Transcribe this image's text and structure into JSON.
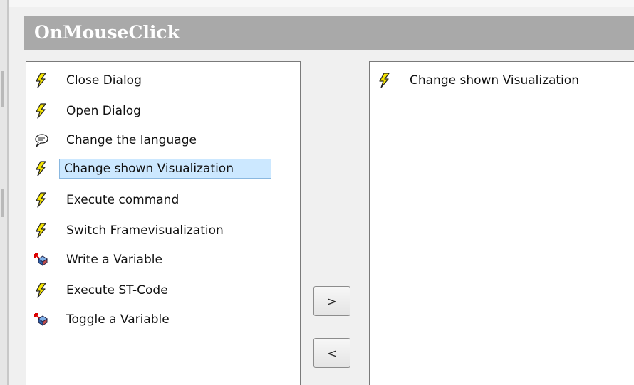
{
  "header": {
    "title": "OnMouseClick"
  },
  "available_actions": {
    "selected_index": 3,
    "items": [
      {
        "label": "Close Dialog",
        "icon": "lightning-icon"
      },
      {
        "label": "Open Dialog",
        "icon": "lightning-icon"
      },
      {
        "label": "Change the language",
        "icon": "speech-bubble-icon"
      },
      {
        "label": "Change shown Visualization",
        "icon": "lightning-icon"
      },
      {
        "label": "Execute command",
        "icon": "lightning-icon"
      },
      {
        "label": "Switch Framevisualization",
        "icon": "lightning-icon"
      },
      {
        "label": "Write a Variable",
        "icon": "variable-cube-icon"
      },
      {
        "label": "Execute ST-Code",
        "icon": "lightning-icon"
      },
      {
        "label": "Toggle a Variable",
        "icon": "variable-cube-icon"
      }
    ]
  },
  "assigned_actions": {
    "items": [
      {
        "label": "Change shown Visualization",
        "icon": "lightning-icon"
      }
    ]
  },
  "buttons": {
    "add_label": ">",
    "remove_label": "<"
  },
  "colors": {
    "header_bg": "#a9a9a9",
    "selection_bg": "#cce8ff",
    "lightning": "#f5e400"
  }
}
